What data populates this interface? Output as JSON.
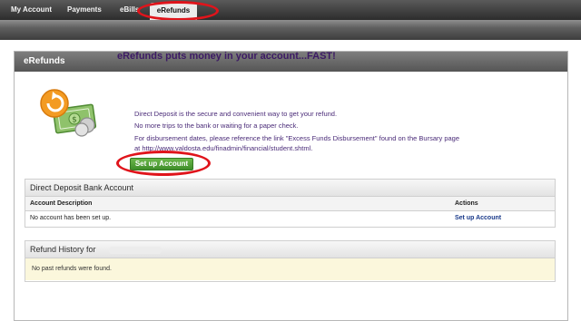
{
  "nav": {
    "tabs": [
      "My Account",
      "Payments",
      "eBills",
      "eRefunds"
    ]
  },
  "panel": {
    "title": "eRefunds"
  },
  "promo": {
    "headline": "eRefunds puts money in your account...FAST!",
    "lines": [
      "Direct Deposit is the secure and convenient way to get your refund.",
      "No more trips to the bank or waiting for a paper check.",
      "For disbursement dates, please reference the link \"Excess Funds Disbursement\" found on the Bursary page",
      "at http://www.valdosta.edu/finadmin/financial/student.shtml."
    ],
    "button": "Set up Account"
  },
  "direct_deposit": {
    "title": "Direct Deposit Bank Account",
    "columns": [
      "Account Description",
      "Actions"
    ],
    "row_text": "No account has been set up.",
    "row_action": "Set up Account"
  },
  "refund_history": {
    "title": "Refund History for",
    "empty_text": "No past refunds were found."
  },
  "colors": {
    "highlight_ring": "#e0141b",
    "button_green": "#4fa136",
    "headline_purple": "#3c1a64"
  }
}
